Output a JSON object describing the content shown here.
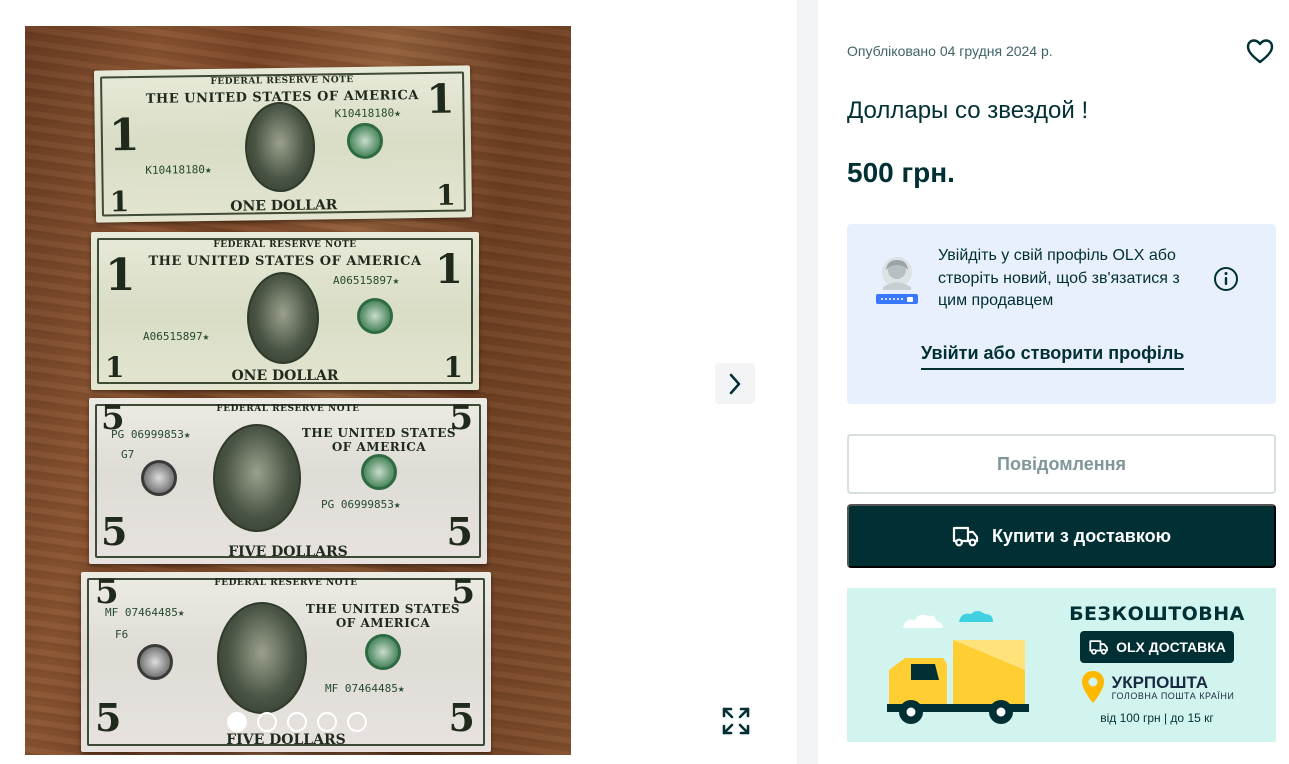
{
  "listing": {
    "published": "Опубліковано 04 грудня 2024 р.",
    "title": "Доллары со звездой !",
    "price": "500 грн."
  },
  "gallery": {
    "photo_count": 5,
    "active_index": 0,
    "bills": [
      {
        "header": "FEDERAL RESERVE NOTE",
        "country": "THE UNITED STATES OF AMERICA",
        "serial": "K10418180★",
        "district": "K",
        "footer": "ONE DOLLAR",
        "value": "1"
      },
      {
        "header": "FEDERAL RESERVE NOTE",
        "country": "THE UNITED STATES OF AMERICA",
        "serial": "A06515897★",
        "district": "A",
        "footer": "ONE DOLLAR",
        "value": "1"
      },
      {
        "header": "FEDERAL RESERVE NOTE",
        "country": "THE UNITED STATES OF AMERICA",
        "serial": "PG 06999853★",
        "district": "G7",
        "footer": "FIVE DOLLARS",
        "value": "5"
      },
      {
        "header": "FEDERAL RESERVE NOTE",
        "country": "THE UNITED STATES OF AMERICA",
        "serial": "MF 07464485★",
        "district": "F6",
        "footer": "FIVE DOLLARS",
        "value": "5"
      }
    ]
  },
  "login_prompt": {
    "text": "Увійдіть у свій профіль OLX або створіть новий, щоб зв'язатися з цим продавцем",
    "link": "Увійти або створити профіль"
  },
  "buttons": {
    "message": "Повідомлення",
    "buy": "Купити з доставкою"
  },
  "promo": {
    "headline": "БЕЗКОШТОВНА",
    "badge": "OLX ДОСТАВКА",
    "carrier": "УКРПОШТА",
    "carrier_sub": "ГОЛОВНА ПОШТА КРАЇНИ",
    "limits": "від 100 грн | до 15 кг"
  },
  "colors": {
    "primary": "#002f34",
    "login_bg": "#e8effd",
    "promo_bg": "#d2f4ef",
    "truck_yellow": "#ffce32",
    "divider": "#f2f4f5"
  }
}
